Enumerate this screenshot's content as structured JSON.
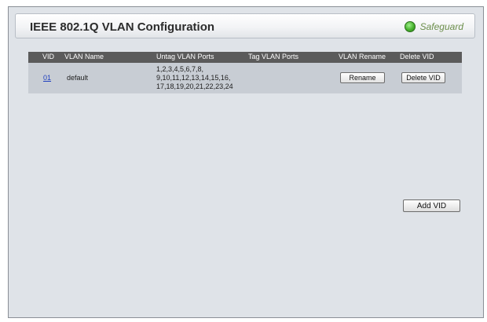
{
  "header": {
    "title": "IEEE 802.1Q VLAN Configuration",
    "safeguard_label": "Safeguard",
    "status_color": "#47b22e"
  },
  "table": {
    "columns": [
      "VID",
      "VLAN Name",
      "Untag VLAN Ports",
      "Tag VLAN Ports",
      "VLAN Rename",
      "Delete VID"
    ],
    "rows": [
      {
        "vid": "01",
        "vlan_name": "default",
        "untag_ports": [
          "1,2,3,4,5,6,7,8,",
          "9,10,11,12,13,14,15,16,",
          "17,18,19,20,21,22,23,24"
        ],
        "tag_ports": "",
        "rename_label": "Rename",
        "delete_label": "Delete VID"
      }
    ]
  },
  "actions": {
    "add_vid_label": "Add VID"
  },
  "colors": {
    "header_bg": "#5b5b5b",
    "row_bg": "#c8cdd4",
    "panel_bg": "#dfe3e8",
    "link": "#1f3fbf"
  }
}
